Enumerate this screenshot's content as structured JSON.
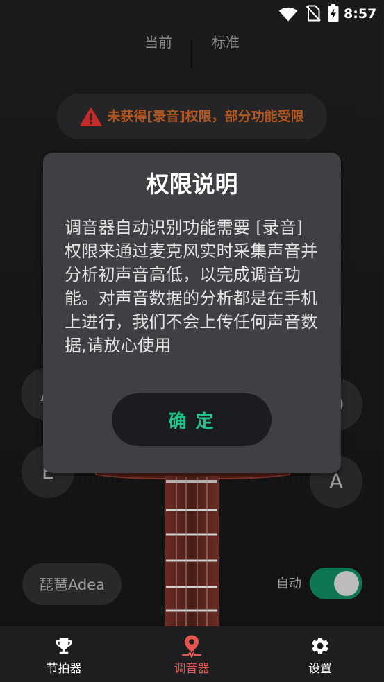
{
  "status_bar": {
    "time": "8:57",
    "icons": {
      "wifi": "wifi-icon",
      "signal": "no-sim-icon",
      "battery": "battery-charging-icon"
    }
  },
  "top_tabs": [
    {
      "label": "当前"
    },
    {
      "label": "标准"
    }
  ],
  "warning_banner": {
    "icon": "warning-icon",
    "text": "未获得[录音]权限，部分功能受限"
  },
  "tuning_pegs": [
    {
      "note": "A"
    },
    {
      "note": "D"
    },
    {
      "note": "E"
    },
    {
      "note": "A"
    }
  ],
  "instrument_selector": {
    "label": "琵琶Adea"
  },
  "auto_mode": {
    "label": "自动",
    "enabled": true
  },
  "dialog": {
    "title": "权限说明",
    "body_lines": [
      "调音器自动识别功能需要 [录音]",
      "权限来通过麦克风实时采集声音并",
      "分析初声音高低，以完成调音功",
      "能。对声音数据的分析都是在手机",
      "上进行，我们不会上传任何声音数",
      "据,请放心使用"
    ],
    "confirm_label": "确 定"
  },
  "bottom_nav": {
    "items": [
      {
        "label": "节拍器",
        "icon": "trophy-icon",
        "active": false
      },
      {
        "label": "调音器",
        "icon": "tuner-pin-icon",
        "active": true
      },
      {
        "label": "设置",
        "icon": "gear-icon",
        "active": false
      }
    ]
  },
  "colors": {
    "accent_green": "#1fc48b",
    "active_nav": "#e8554f",
    "warning_text": "#b3561f",
    "warning_icon": "#c22b28",
    "toggle_on": "#0e7651",
    "dialog_bg": "#3f3f44"
  }
}
